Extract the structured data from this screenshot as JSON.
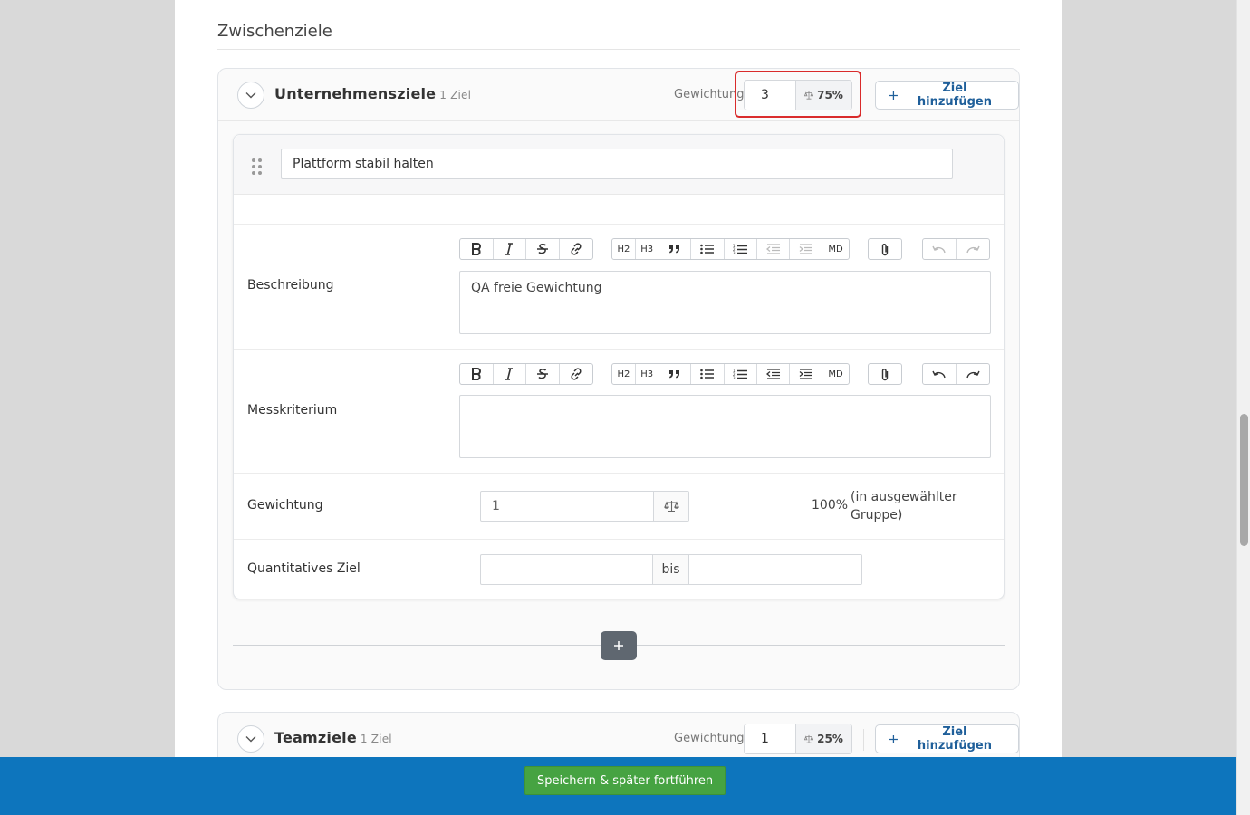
{
  "section": {
    "title": "Zwischenziele"
  },
  "groups": [
    {
      "title": "Unternehmensziele",
      "count": "1 Ziel",
      "weight_label": "Gewichtung",
      "weight_value": "3",
      "weight_percent": "75%",
      "add_label": "Ziel hinzufügen",
      "highlighted": true
    },
    {
      "title": "Teamziele",
      "count": "1 Ziel",
      "weight_label": "Gewichtung",
      "weight_value": "1",
      "weight_percent": "25%",
      "add_label": "Ziel hinzufügen",
      "highlighted": false
    }
  ],
  "goal": {
    "title_value": "Plattform stabil halten",
    "description_label": "Beschreibung",
    "description_text": "QA freie Gewichtung",
    "criterion_label": "Messkriterium",
    "criterion_text": "",
    "weight_label": "Gewichtung",
    "weight_value": "1",
    "weight_percent": "100%",
    "weight_note": "(in ausgewählter Gruppe)",
    "quant_label": "Quantitatives Ziel",
    "quant_from": "",
    "quant_separator": "bis",
    "quant_to": ""
  },
  "toolbar": {
    "h2": "H2",
    "h3": "H3",
    "md": "MD"
  },
  "footer": {
    "save_label": "Speichern & später fortführen"
  },
  "colors": {
    "accent": "#1f5f9a",
    "footer_bg": "#0d75bd",
    "save_button": "#46a342",
    "highlight": "#d92b2b"
  }
}
